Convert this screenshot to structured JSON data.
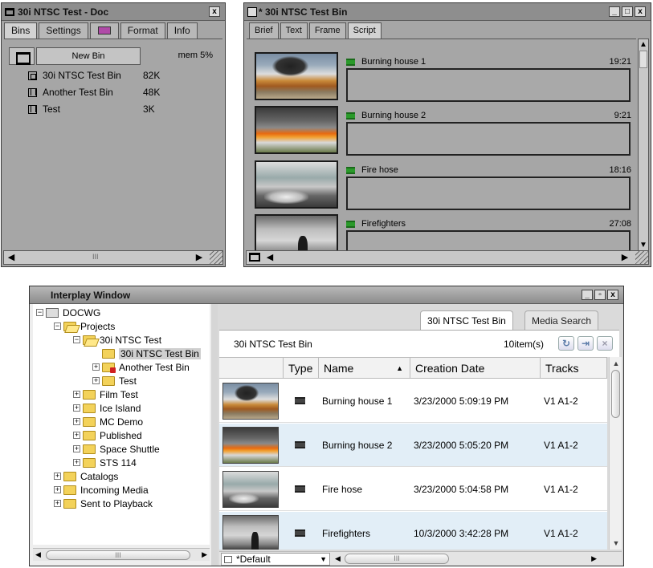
{
  "doc_window": {
    "title": "30i NTSC Test - Doc",
    "close": "x",
    "tabs": [
      "Bins",
      "Settings",
      "",
      "Format",
      "Info"
    ],
    "new_bin_label": "New Bin",
    "mem": "mem 5%",
    "bins": [
      {
        "name": "30i NTSC Test Bin",
        "size": "82K",
        "icon": "frame-view-icon"
      },
      {
        "name": "Another Test Bin",
        "size": "48K",
        "icon": "script-view-icon"
      },
      {
        "name": "Test",
        "size": "3K",
        "icon": "script-view-icon"
      }
    ],
    "scroll_mid": "III"
  },
  "script_window": {
    "title": "* 30i NTSC Test Bin",
    "tabs": [
      "Brief",
      "Text",
      "Frame",
      "Script"
    ],
    "clips": [
      {
        "name": "Burning house 1",
        "duration": "19:21"
      },
      {
        "name": "Burning house 2",
        "duration": "9:21"
      },
      {
        "name": "Fire hose",
        "duration": "18:16"
      },
      {
        "name": "Firefighters",
        "duration": "27:08"
      }
    ]
  },
  "interplay": {
    "title": "Interplay Window",
    "tree": [
      {
        "label": "DOCWG",
        "kind": "db",
        "level": 0,
        "expanded": true
      },
      {
        "label": "Projects",
        "kind": "folder-open",
        "level": 1,
        "expanded": true
      },
      {
        "label": "30i NTSC Test",
        "kind": "folder-open",
        "level": 2,
        "expanded": true
      },
      {
        "label": "30i NTSC Test Bin",
        "kind": "folder",
        "level": 3,
        "selected": true
      },
      {
        "label": "Another Test Bin",
        "kind": "folder-red",
        "level": 3,
        "expanded": false
      },
      {
        "label": "Test",
        "kind": "folder",
        "level": 3,
        "expanded": false
      },
      {
        "label": "Film Test",
        "kind": "folder",
        "level": 2,
        "expanded": false
      },
      {
        "label": "Ice Island",
        "kind": "folder",
        "level": 2,
        "expanded": false
      },
      {
        "label": "MC Demo",
        "kind": "folder",
        "level": 2,
        "expanded": false
      },
      {
        "label": "Published",
        "kind": "folder",
        "level": 2,
        "expanded": false
      },
      {
        "label": "Space Shuttle",
        "kind": "folder",
        "level": 2,
        "expanded": false
      },
      {
        "label": "STS 114",
        "kind": "folder",
        "level": 2,
        "expanded": false
      },
      {
        "label": "Catalogs",
        "kind": "folder",
        "level": 1,
        "expanded": false
      },
      {
        "label": "Incoming Media",
        "kind": "folder",
        "level": 1,
        "expanded": false
      },
      {
        "label": "Sent to Playback",
        "kind": "folder",
        "level": 1,
        "expanded": false
      }
    ],
    "tabs": [
      "30i NTSC Test Bin",
      "Media Search"
    ],
    "bin_name": "30i NTSC Test Bin",
    "item_count": "10item(s)",
    "columns": [
      "Type",
      "Name",
      "Creation Date",
      "Tracks"
    ],
    "rows": [
      {
        "name": "Burning house 1",
        "date": "3/23/2000 5:09:19 PM",
        "tracks": "V1 A1-2"
      },
      {
        "name": "Burning house 2",
        "date": "3/23/2000 5:05:20 PM",
        "tracks": "V1 A1-2"
      },
      {
        "name": "Fire hose",
        "date": "3/23/2000 5:04:58 PM",
        "tracks": "V1 A1-2"
      },
      {
        "name": "Firefighters",
        "date": "10/3/2000 3:42:28 PM",
        "tracks": "V1 A1-2"
      }
    ],
    "view": "*Default",
    "scroll_mid": "III"
  }
}
